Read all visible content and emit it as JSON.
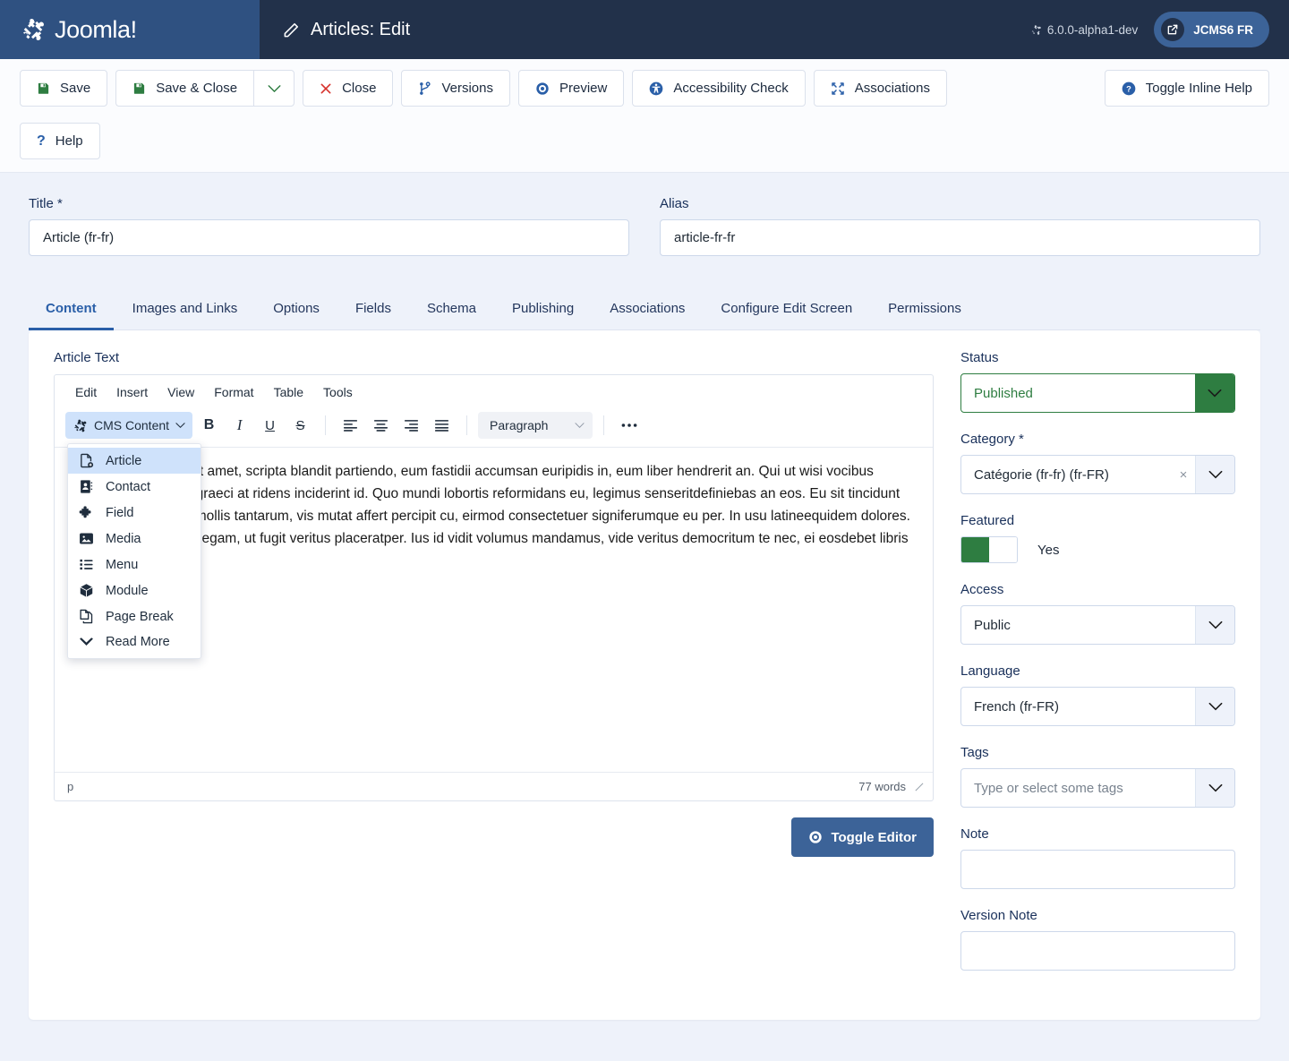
{
  "header": {
    "brand": "Joomla!",
    "title": "Articles: Edit",
    "title_icon": "pencil-icon",
    "version": "6.0.0-alpha1-dev",
    "site_button": "JCMS6 FR",
    "site_button_icon": "external-link-icon"
  },
  "toolbar": {
    "save": "Save",
    "save_close": "Save & Close",
    "save_dropdown_icon": "chevron-down-icon",
    "close": "Close",
    "versions": "Versions",
    "preview": "Preview",
    "accessibility": "Accessibility Check",
    "associations": "Associations",
    "toggle_inline_help": "Toggle Inline Help",
    "help": "Help"
  },
  "form": {
    "title_label": "Title *",
    "title_value": "Article (fr-fr)",
    "title_placeholder": "",
    "alias_label": "Alias",
    "alias_value": "article-fr-fr",
    "alias_placeholder": ""
  },
  "tabs": [
    {
      "label": "Content",
      "active": true
    },
    {
      "label": "Images and Links",
      "active": false
    },
    {
      "label": "Options",
      "active": false
    },
    {
      "label": "Fields",
      "active": false
    },
    {
      "label": "Schema",
      "active": false
    },
    {
      "label": "Publishing",
      "active": false
    },
    {
      "label": "Associations",
      "active": false
    },
    {
      "label": "Configure Edit Screen",
      "active": false
    },
    {
      "label": "Permissions",
      "active": false
    }
  ],
  "editor": {
    "label": "Article Text",
    "menubar": [
      "Edit",
      "Insert",
      "View",
      "Format",
      "Table",
      "Tools"
    ],
    "cms_content_button": "CMS Content",
    "format_select": "Paragraph",
    "more_button": "...",
    "body_text": "Lorem ipsum dolor sit amet, scripta blandit partiendo, eum fastidii accumsan euripidis in, eum liber hendrerit an. Qui ut wisi vocibus consectetuer, pro ei graeci at ridens inciderint id. Quo mundi lobortis reformidans eu, legimus senseritdefiniebas an eos. Eu sit tincidunt intellegebat, nec eu mollis tantarum, vis mutat affert percipit cu, eirmod consectetuer signiferumque eu per. In usu latineequidem dolores. Quo no falli viris intellegam, ut fugit veritus placeratper. Ius id vidit volumus mandamus, vide veritus democritum te nec, ei eosdebet libris consulatu.",
    "status_path": "p",
    "word_count": "77 words",
    "cms_menu": [
      {
        "label": "Article",
        "icon": "file-plus-icon",
        "highlighted": true
      },
      {
        "label": "Contact",
        "icon": "address-book-icon",
        "highlighted": false
      },
      {
        "label": "Field",
        "icon": "puzzle-piece-icon",
        "highlighted": false
      },
      {
        "label": "Media",
        "icon": "image-icon",
        "highlighted": false
      },
      {
        "label": "Menu",
        "icon": "list-icon",
        "highlighted": false
      },
      {
        "label": "Module",
        "icon": "cube-icon",
        "highlighted": false
      },
      {
        "label": "Page Break",
        "icon": "copy-pages-icon",
        "highlighted": false
      },
      {
        "label": "Read More",
        "icon": "chevron-double-down-icon",
        "highlighted": false
      }
    ],
    "toggle_editor": "Toggle Editor",
    "toggle_editor_icon": "eye-icon"
  },
  "sidebar": {
    "status_label": "Status",
    "status_value": "Published",
    "category_label": "Category *",
    "category_value": "Catégorie (fr-fr) (fr-FR)",
    "featured_label": "Featured",
    "featured_value": "Yes",
    "access_label": "Access",
    "access_value": "Public",
    "language_label": "Language",
    "language_value": "French (fr-FR)",
    "tags_label": "Tags",
    "tags_placeholder": "Type or select some tags",
    "note_label": "Note",
    "note_value": "",
    "version_note_label": "Version Note",
    "version_note_value": ""
  },
  "colors": {
    "brand_blue": "#2f5181",
    "header_dark": "#22314a",
    "accent": "#2a5fa8",
    "published_green": "#2e7d41",
    "danger_red": "#d6312b",
    "page_bg": "#eef2fa"
  }
}
